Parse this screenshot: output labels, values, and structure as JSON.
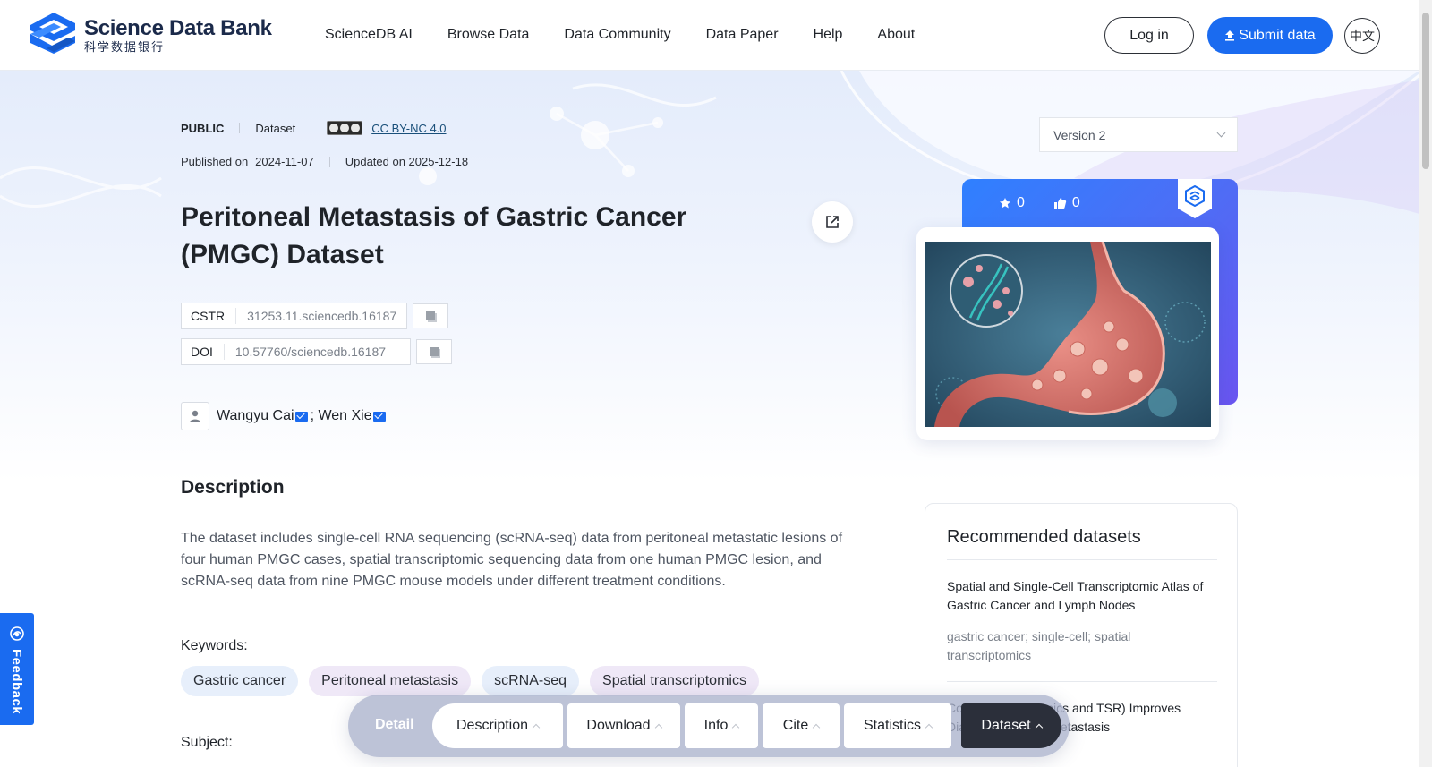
{
  "header": {
    "logo_en": "Science Data Bank",
    "logo_cn": "科学数据银行",
    "nav": [
      "ScienceDB AI",
      "Browse Data",
      "Data Community",
      "Data Paper",
      "Help",
      "About"
    ],
    "login_label": "Log in",
    "submit_label": "Submit data",
    "lang_label": "中文"
  },
  "dataset": {
    "access": "PUBLIC",
    "type": "Dataset",
    "license": "CC BY-NC 4.0",
    "published_label": "Published on",
    "published_date": "2024-11-07",
    "updated": "Updated on 2025-12-18",
    "title": "Peritoneal Metastasis of Gastric Cancer (PMGC) Dataset",
    "cstr_label": "CSTR",
    "cstr_value": "31253.11.sciencedb.16187",
    "doi_label": "DOI",
    "doi_value": "10.57760/sciencedb.16187",
    "authors": [
      "Wangyu Cai",
      "Wen Xie"
    ],
    "author_sep": "; ",
    "version": "Version 2",
    "stars": "0",
    "likes": "0"
  },
  "description": {
    "heading": "Description",
    "text": "The dataset includes single-cell RNA sequencing (scRNA-seq) data from peritoneal metastatic lesions of four human PMGC cases, spatial transcriptomic sequencing data from one human PMGC lesion, and scRNA-seq data from nine PMGC mouse models under different treatment conditions.",
    "keywords_label": "Keywords:",
    "keywords": [
      "Gastric cancer",
      "Peritoneal metastasis",
      "scRNA-seq",
      "Spatial transcriptomics"
    ],
    "subject_label": "Subject:"
  },
  "recommended": {
    "heading": "Recommended datasets",
    "item1_title": "Spatial and Single-Cell Transcriptomic Atlas of Gastric Cancer and Lymph Nodes",
    "item1_keywords": "gastric cancer; single-cell; spatial transcriptomics",
    "item2_title": "Combining Radiomics and TSR) Improves Diagnosis ritoneal Metastasis"
  },
  "feedback_label": "Feedback",
  "tabbar": {
    "detail": "Detail",
    "tabs": [
      "Description",
      "Download",
      "Info",
      "Cite",
      "Statistics",
      "Dataset"
    ],
    "active": "Dataset"
  },
  "colors": {
    "primary": "#1a6bf0",
    "tab_active": "#2b2f3a",
    "keyword_blue": "#e7effb",
    "keyword_purple": "#efe8f7"
  }
}
